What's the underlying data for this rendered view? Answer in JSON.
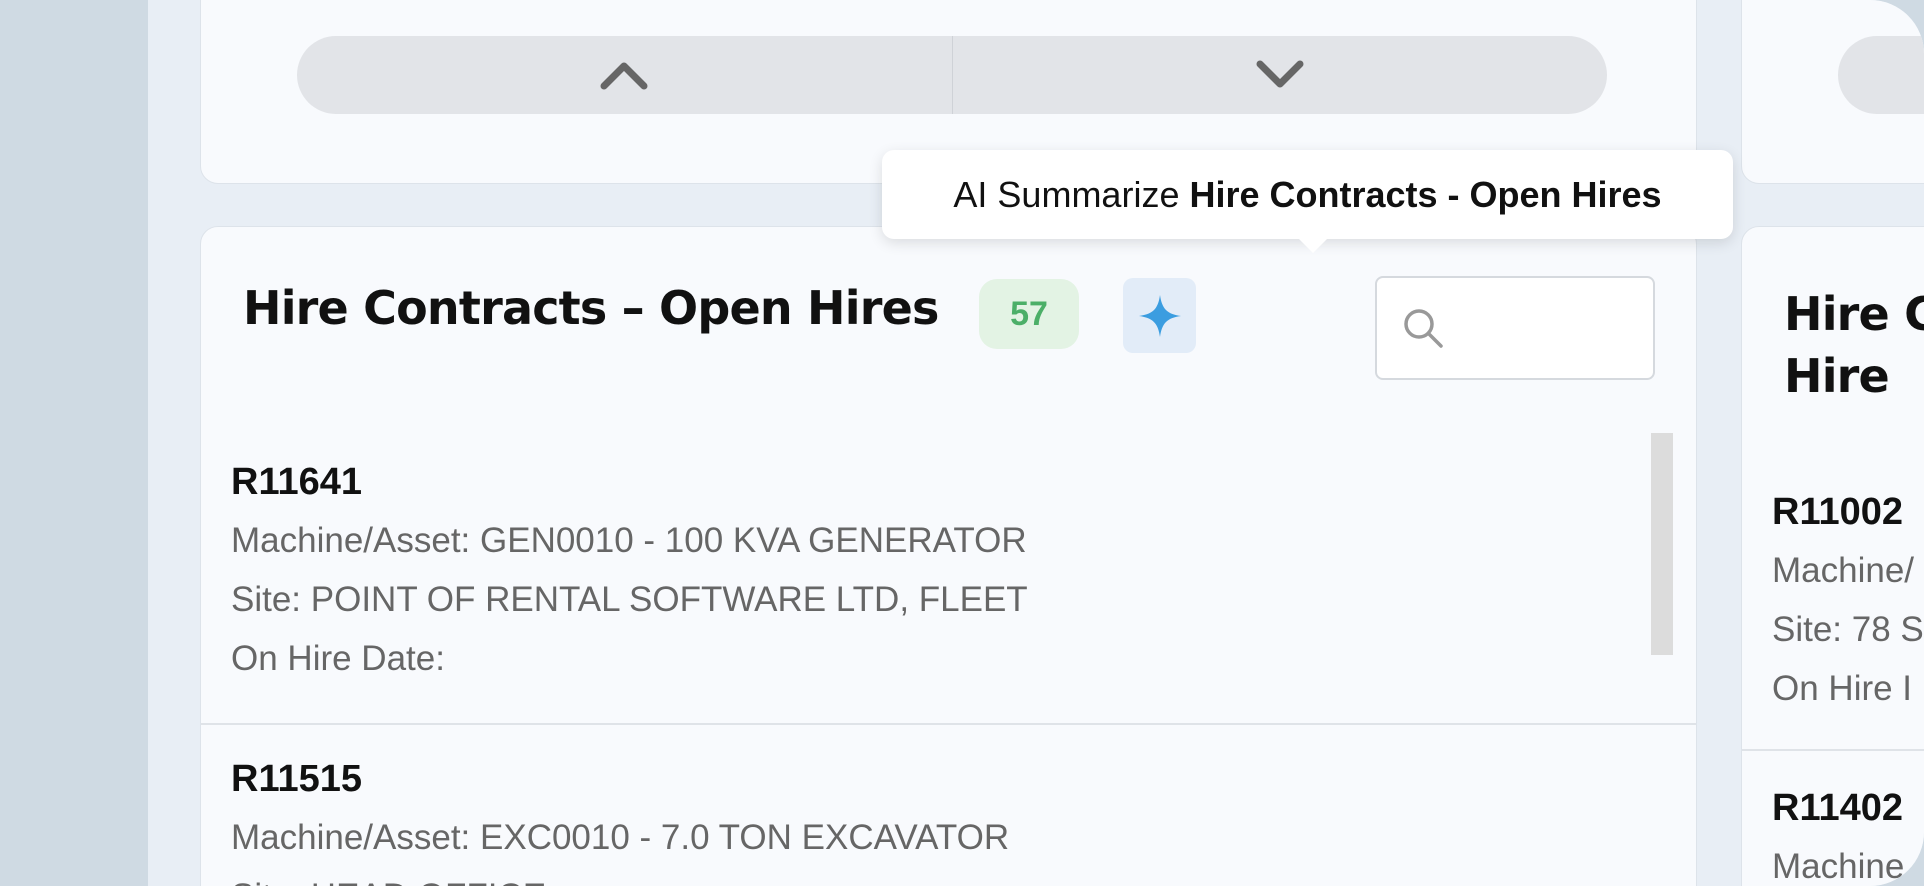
{
  "tooltip": {
    "prefix": "AI Summarize",
    "target": "Hire Contracts - Open Hires"
  },
  "icons": {
    "up": "chevron-up-icon",
    "down": "chevron-down-icon",
    "ai": "sparkle-icon",
    "search": "search-icon"
  },
  "colors": {
    "badge_text": "#4caf68",
    "ai_icon": "#3b9de0"
  },
  "main_card": {
    "title": "Hire Contracts – Open Hires",
    "count": "57",
    "search": {
      "value": "",
      "placeholder": ""
    },
    "items": [
      {
        "id": "R11641",
        "machine": "Machine/Asset: GEN0010 - 100 KVA GENERATOR",
        "site": "Site: POINT OF RENTAL SOFTWARE LTD, FLEET",
        "on_hire": "On Hire Date:"
      },
      {
        "id": "R11515",
        "machine": "Machine/Asset: EXC0010 - 7.0 TON EXCAVATOR",
        "site": "Site: HEAD OFFICE"
      }
    ]
  },
  "side_card": {
    "title_line1": "Hire C",
    "title_line2": "Hire",
    "items": [
      {
        "id": "R11002",
        "machine": "Machine/",
        "site": "Site: 78 S",
        "on_hire": "On Hire I"
      },
      {
        "id": "R11402",
        "machine": "Machine"
      }
    ]
  }
}
